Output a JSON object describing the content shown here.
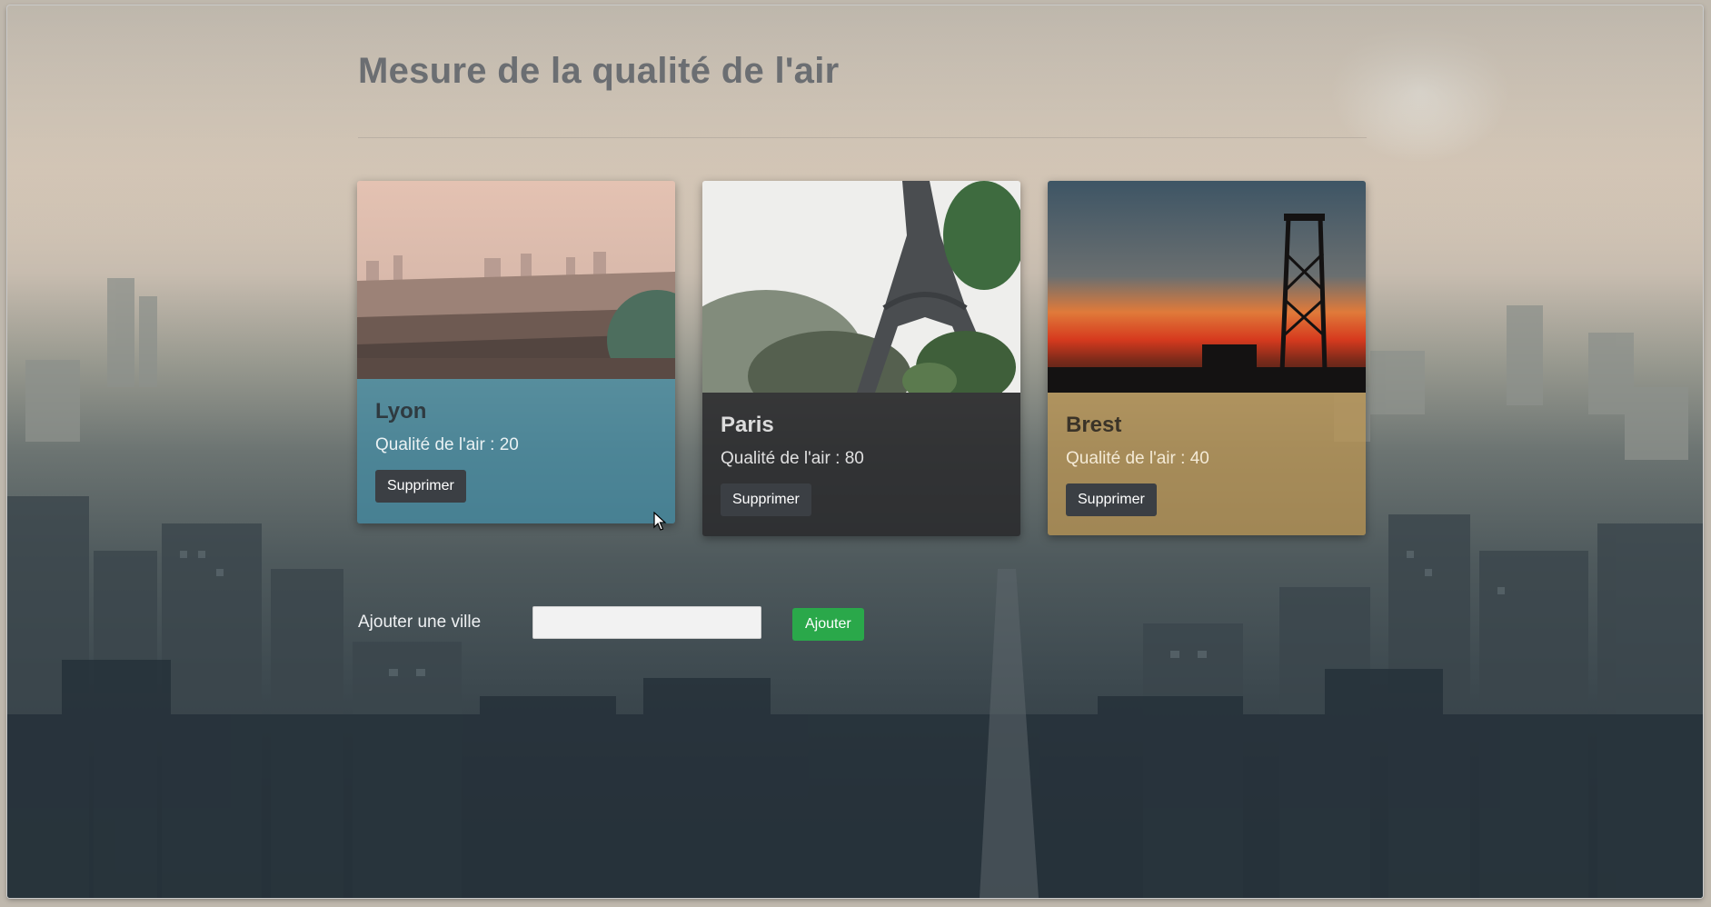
{
  "page": {
    "title": "Mesure de la qualité de l'air"
  },
  "cities": [
    {
      "name": "Lyon",
      "aqi_text": "Qualité de l'air : 20",
      "aqi": 20,
      "delete_label": "Supprimer",
      "accent": "#418ca5"
    },
    {
      "name": "Paris",
      "aqi_text": "Qualité de l'air : 80",
      "aqi": 80,
      "delete_label": "Supprimer",
      "accent": "#28282a"
    },
    {
      "name": "Brest",
      "aqi_text": "Qualité de l'air : 40",
      "aqi": 40,
      "delete_label": "Supprimer",
      "accent": "#be9650"
    }
  ],
  "add_city": {
    "label": "Ajouter une ville",
    "input_value": "",
    "button_label": "Ajouter",
    "button_color": "#2aa84a"
  }
}
